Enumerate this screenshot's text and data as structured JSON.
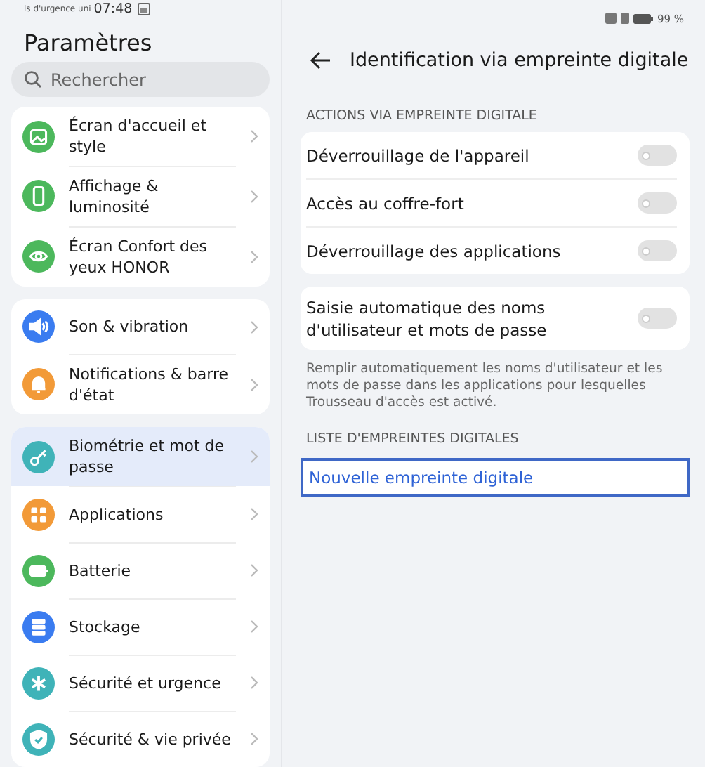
{
  "status_bar": {
    "carrier": "ls d'urgence uni",
    "time": "07:48",
    "battery": "99 %"
  },
  "sidebar": {
    "title": "Paramètres",
    "search": {
      "placeholder": "Rechercher"
    },
    "groups": [
      {
        "items": [
          {
            "label": "Écran d'accueil et style",
            "color": "#4cb85c",
            "selected": false
          },
          {
            "label": "Affichage & luminosité",
            "color": "#4cb85c",
            "selected": false
          },
          {
            "label": "Écran Confort des yeux HONOR",
            "color": "#4cb85c",
            "selected": false
          }
        ]
      },
      {
        "items": [
          {
            "label": "Son & vibration",
            "color": "#3a7cf0",
            "selected": false
          },
          {
            "label": "Notifications & barre d'état",
            "color": "#f29a38",
            "selected": false
          }
        ]
      },
      {
        "items": [
          {
            "label": "Biométrie et mot de passe",
            "color": "#3fb3b8",
            "selected": true
          },
          {
            "label": "Applications",
            "color": "#f29a38",
            "selected": false
          },
          {
            "label": "Batterie",
            "color": "#4cb85c",
            "selected": false
          },
          {
            "label": "Stockage",
            "color": "#3a7cf0",
            "selected": false
          },
          {
            "label": "Sécurité et urgence",
            "color": "#3fb3b8",
            "selected": false
          },
          {
            "label": "Sécurité & vie privée",
            "color": "#3fb3b8",
            "selected": false
          }
        ]
      }
    ]
  },
  "detail": {
    "title": "Identification via empreinte digitale",
    "section_1": "ACTIONS VIA EMPREINTE DIGITALE",
    "toggles": [
      {
        "label": "Déverrouillage de l'appareil",
        "on": false
      },
      {
        "label": "Accès au coffre-fort",
        "on": false
      },
      {
        "label": "Déverrouillage des applications",
        "on": false
      }
    ],
    "autofill": {
      "label": "Saisie automatique des noms d'utilisateur et mots de passe",
      "on": false
    },
    "autofill_note": "Remplir automatiquement les noms d'utilisateur et les mots de passe dans les applications pour lesquelles Trousseau d'accès est activé.",
    "section_2": "LISTE D'EMPREINTES DIGITALES",
    "new_button": "Nouvelle empreinte digitale"
  }
}
